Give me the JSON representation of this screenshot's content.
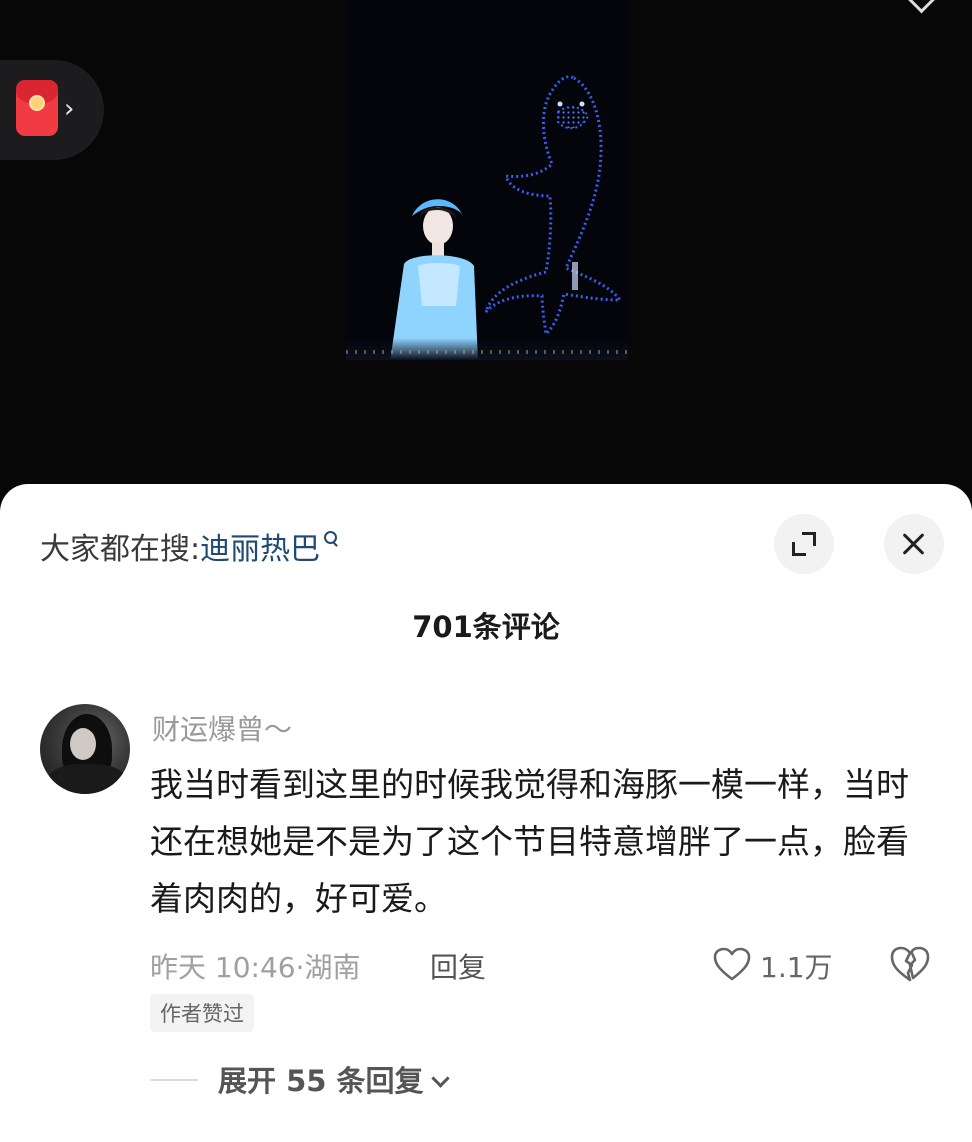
{
  "video": {
    "hongbao_icon": "red-envelope-icon",
    "hongbao_arrow": "›"
  },
  "sheet": {
    "search": {
      "prefix": "大家都在搜:",
      "term": "迪丽热巴",
      "icon": "search-icon"
    },
    "buttons": {
      "expand_icon": "expand-icon",
      "close_icon": "close-icon"
    },
    "comment_count": "701条评论"
  },
  "comment": {
    "username": "财运爆曾～",
    "text": "我当时看到这里的时候我觉得和海豚一模一样，当时还在想她是不是为了这个节目特意增胖了一点，脸看着肉肉的，好可爱。",
    "time": "昨天 10:46",
    "location": "湖南",
    "meta_sep": "·",
    "reply_label": "回复",
    "like_count": "1.1万",
    "like_icon": "heart-outline-icon",
    "dislike_icon": "broken-heart-icon",
    "author_badge": "作者赞过",
    "expand_replies": "展开 55 条回复"
  },
  "colors": {
    "sheet_bg": "#ffffff",
    "search_term": "#1f4a73",
    "hongbao_red": "#f23a43",
    "drone_blue": "#3a64ff"
  }
}
